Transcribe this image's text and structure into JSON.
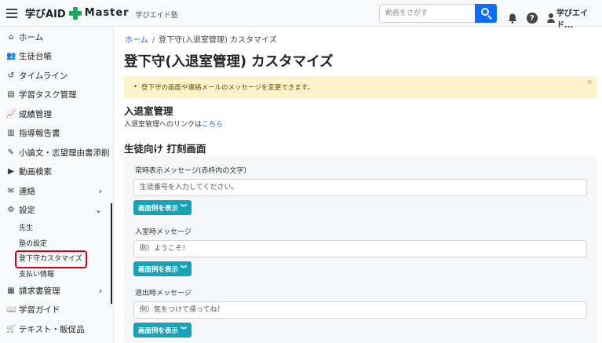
{
  "header": {
    "app_name": "学びAID",
    "app_name_suffix": "Master",
    "school": "学びエイド塾",
    "search_placeholder": "動画をさがす",
    "user_name": "学びエイド..."
  },
  "sidebar": {
    "items": [
      {
        "label": "ホーム",
        "icon": "home-icon",
        "glyph": "⌂"
      },
      {
        "label": "生徒台帳",
        "icon": "users-icon",
        "glyph": "👥"
      },
      {
        "label": "タイムライン",
        "icon": "history-icon",
        "glyph": "↺"
      },
      {
        "label": "学習タスク管理",
        "icon": "clipboard-icon",
        "glyph": "▤"
      },
      {
        "label": "成績管理",
        "icon": "chart-line-icon",
        "glyph": "📈"
      },
      {
        "label": "指導報告書",
        "icon": "document-icon",
        "glyph": "▥"
      },
      {
        "label": "小論文・志望理由書添削",
        "icon": "pen-icon",
        "glyph": "✎"
      },
      {
        "label": "動画検索",
        "icon": "video-icon",
        "glyph": "▶"
      },
      {
        "label": "連絡",
        "icon": "message-icon",
        "glyph": "✉"
      },
      {
        "label": "設定",
        "icon": "gears-icon",
        "glyph": "⚙"
      },
      {
        "label": "請求書管理",
        "icon": "invoice-icon",
        "glyph": "▦"
      },
      {
        "label": "学習ガイド",
        "icon": "book-icon",
        "glyph": "📖"
      },
      {
        "label": "テキスト・販促品",
        "icon": "cart-icon",
        "glyph": "🛒"
      }
    ],
    "settings_sub": [
      "先生",
      "塾の設定",
      "登下守カスタマイズ",
      "支払い情報"
    ]
  },
  "main": {
    "breadcrumb": {
      "home": "ホーム",
      "current": "登下守(入退室管理) カスタマイズ"
    },
    "title": "登下守(入退室管理) カスタマイズ",
    "alert": "登下守の画面や連絡メールのメッセージを変更できます。",
    "alert_close": "×",
    "section1": {
      "title": "入退室管理",
      "text": "入退室管理へのリンクは",
      "link": "こちら"
    },
    "section2": {
      "title": "生徒向け 打刻画面"
    },
    "fields": [
      {
        "label": "常時表示メッセージ(赤枠内の文字)",
        "value": "生徒番号を入力してください。"
      },
      {
        "label": "入室時メッセージ",
        "value": "例）ようこそ！"
      },
      {
        "label": "退出時メッセージ",
        "value": "例）気をつけて帰ってね！"
      }
    ],
    "preview_button": "画面例を表示"
  }
}
